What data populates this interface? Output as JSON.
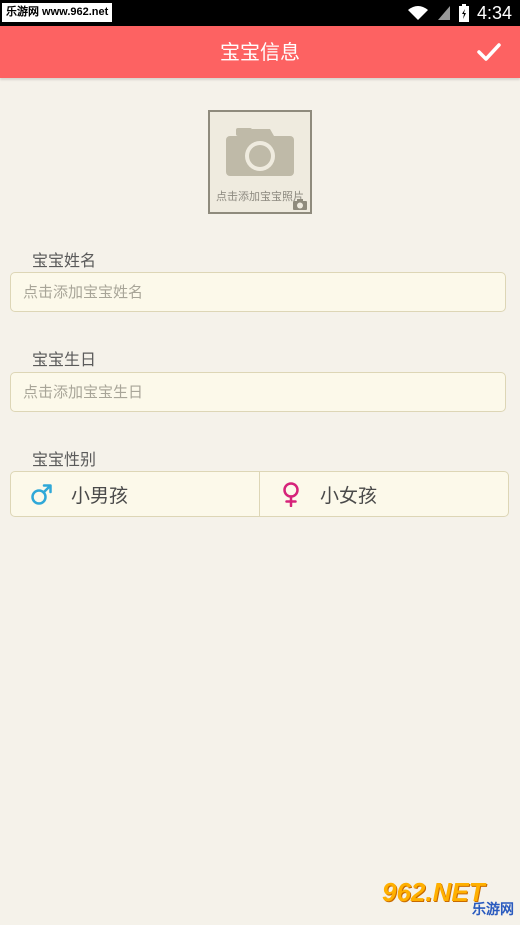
{
  "status_bar": {
    "watermark": "乐游网 www.962.net",
    "time": "4:34"
  },
  "app_bar": {
    "title": "宝宝信息",
    "confirm_icon": "check-icon"
  },
  "photo": {
    "hint": "点击添加宝宝照片",
    "icon": "camera-icon"
  },
  "form": {
    "name_label": "宝宝姓名",
    "name_placeholder": "点击添加宝宝姓名",
    "birthday_label": "宝宝生日",
    "birthday_placeholder": "点击添加宝宝生日",
    "gender_label": "宝宝性别",
    "gender_options": [
      {
        "label": "小男孩",
        "icon": "male-icon",
        "color": "#2fa8d8"
      },
      {
        "label": "小女孩",
        "icon": "female-icon",
        "color": "#d6237a"
      }
    ]
  },
  "footer_logo": {
    "big": "962.NET",
    "small": "乐游网"
  },
  "colors": {
    "accent": "#fd6262",
    "background": "#f5f2ea"
  }
}
